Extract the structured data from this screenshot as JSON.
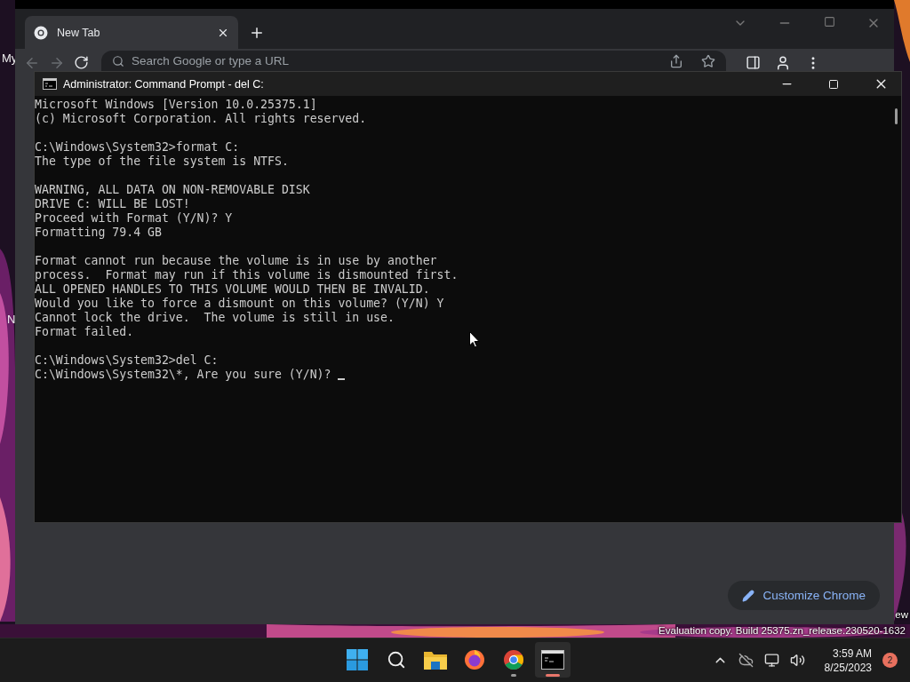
{
  "desktop": {
    "icon_labels": [
      "My",
      "N"
    ],
    "watermark": [
      "ew",
      "Evaluation copy. Build 25375.zn_release.230520-1632"
    ]
  },
  "chrome": {
    "tabs": [
      {
        "title": "New Tab",
        "selected": true
      }
    ],
    "address": {
      "placeholder": "Search Google or type a URL"
    },
    "customize_button": "Customize Chrome"
  },
  "cmd": {
    "title": "Administrator:  Command Prompt - del  C:",
    "paragraphs": [
      [
        "Microsoft Windows [Version 10.0.25375.1]",
        "(c) Microsoft Corporation. All rights reserved."
      ],
      [
        "C:\\Windows\\System32>format C:",
        "The type of the file system is NTFS."
      ],
      [
        "WARNING, ALL DATA ON NON-REMOVABLE DISK",
        "DRIVE C: WILL BE LOST!",
        "Proceed with Format (Y/N)? Y",
        "Formatting 79.4 GB"
      ],
      [
        "Format cannot run because the volume is in use by another",
        "process.  Format may run if this volume is dismounted first.",
        "ALL OPENED HANDLES TO THIS VOLUME WOULD THEN BE INVALID.",
        "Would you like to force a dismount on this volume? (Y/N) Y",
        "Cannot lock the drive.  The volume is still in use.",
        "Format failed."
      ],
      [
        "C:\\Windows\\System32>del C:",
        "C:\\Windows\\System32\\*, Are you sure (Y/N)? "
      ]
    ],
    "cursor": true
  },
  "taskbar": {
    "apps": [
      {
        "kind": "start",
        "running": false,
        "selected": false
      },
      {
        "kind": "search",
        "running": false,
        "selected": false
      },
      {
        "kind": "files",
        "running": false,
        "selected": false
      },
      {
        "kind": "firefox",
        "running": false,
        "selected": false
      },
      {
        "kind": "chrome",
        "running": true,
        "selected": false
      },
      {
        "kind": "terminal",
        "running": true,
        "selected": true
      }
    ],
    "time": "3:59 AM",
    "date": "8/25/2023",
    "notifications": "2"
  }
}
